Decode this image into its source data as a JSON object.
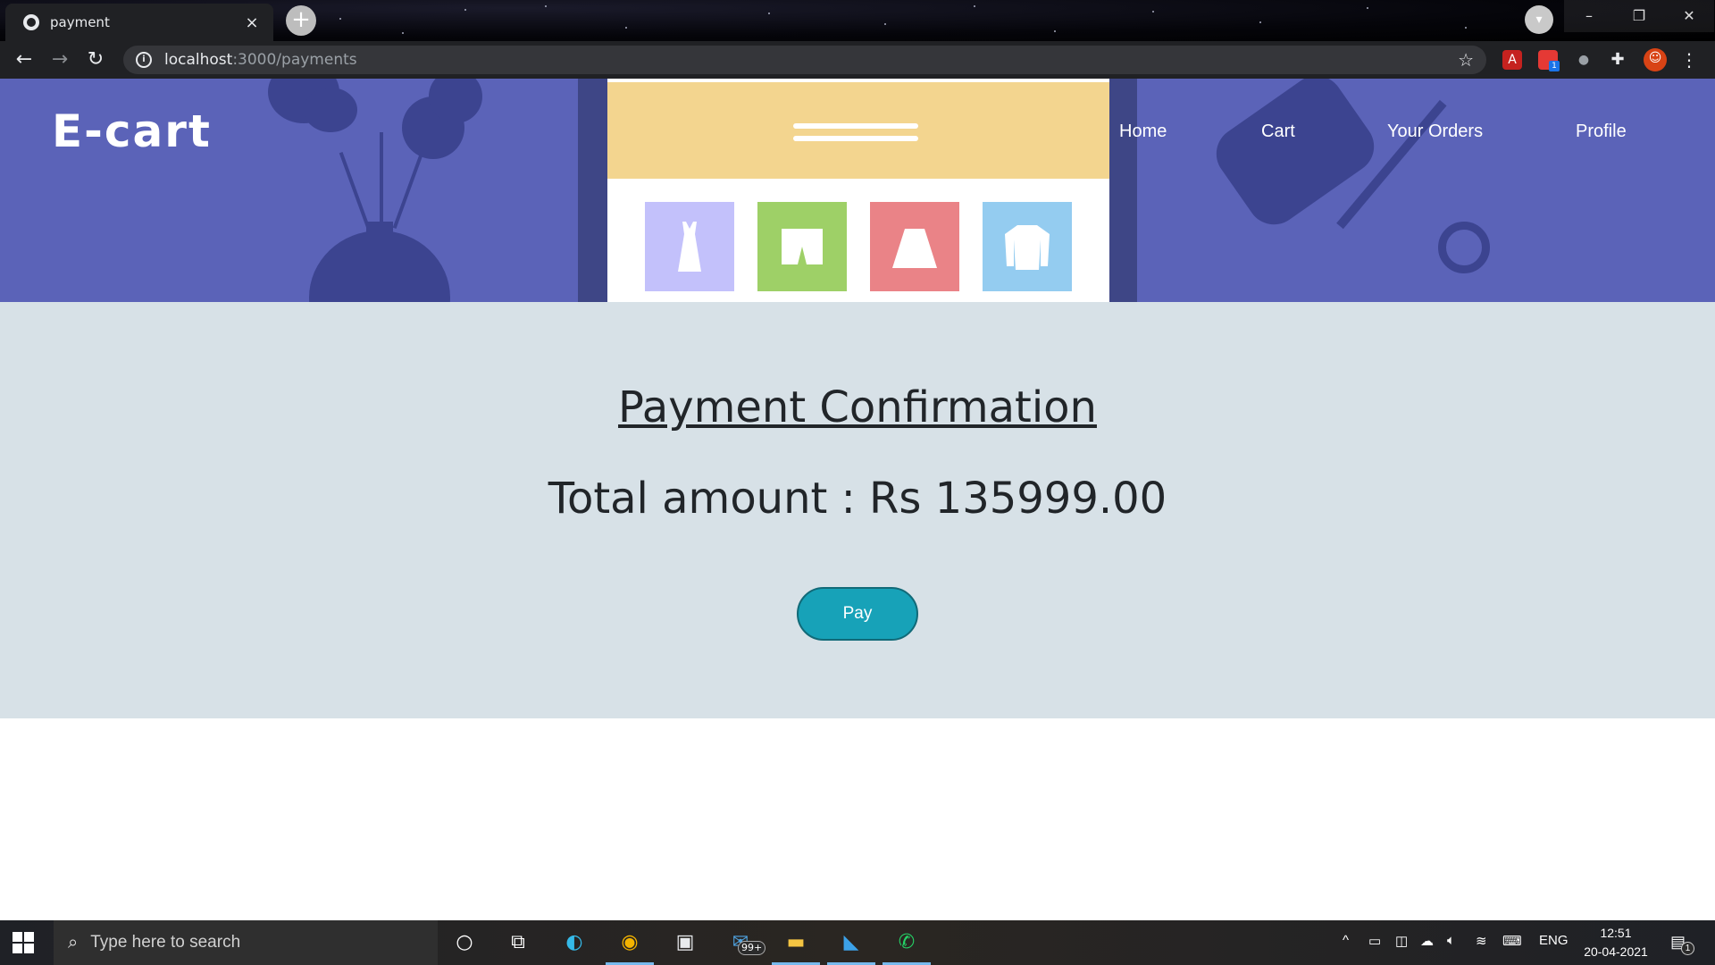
{
  "browser": {
    "tab_title": "payment",
    "tab_close": "×",
    "new_tab": "+",
    "url_host": "localhost",
    "url_path": ":3000/payments",
    "window_controls": {
      "minimize": "–",
      "maximize": "❐",
      "close": "✕"
    },
    "icons": [
      "back-icon",
      "forward-icon",
      "reload-icon",
      "info-icon",
      "bookmark-star-icon",
      "pdf-extension-icon",
      "cast-extension-icon",
      "extensions-puzzle-icon",
      "profile-avatar-icon",
      "kebab-menu-icon"
    ],
    "cast_badge": "1"
  },
  "site": {
    "brand": "E-cart",
    "nav": [
      "Home",
      "Cart",
      "Your Orders",
      "Profile"
    ],
    "colors": {
      "hero": "#5b63b8",
      "section": "#d7e1e7",
      "pay": "#17a2b8"
    }
  },
  "payment": {
    "title": "Payment Confirmation",
    "total": "Total amount : Rs 135999.00",
    "pay_label": "Pay"
  },
  "taskbar": {
    "search_placeholder": "Type here to search",
    "mail_badge": "99+",
    "language": "ENG",
    "time": "12:51",
    "date": "20-04-2021",
    "notifications_badge": "1",
    "apps": [
      "cortana-icon",
      "task-view-icon",
      "edge-icon",
      "chrome-icon",
      "store-icon",
      "mail-icon",
      "file-explorer-icon",
      "vscode-icon",
      "whatsapp-icon"
    ]
  }
}
